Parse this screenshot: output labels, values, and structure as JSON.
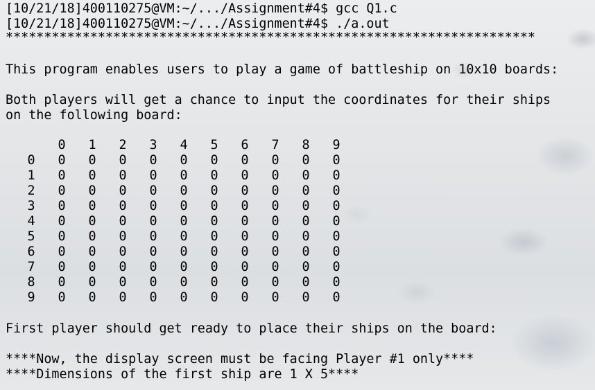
{
  "terminal": {
    "lines": {
      "prompt1": "[10/21/18]400110275@VM:~/.../Assignment#4$ gcc Q1.c",
      "prompt2": "[10/21/18]400110275@VM:~/.../Assignment#4$ ./a.out",
      "stars": "*********************************************************************",
      "intro": "This program enables users to play a game of battleship on 10x10 boards:",
      "both1": "Both players will get a chance to input the coordinates for their ships",
      "both2": "on the following board:",
      "first": "First player should get ready to place their ships on the board:",
      "now": "****Now, the display screen must be facing Player #1 only****",
      "dims": "****Dimensions of the first ship are 1 X 5****"
    },
    "board": {
      "col_headers": [
        "0",
        "1",
        "2",
        "3",
        "4",
        "5",
        "6",
        "7",
        "8",
        "9"
      ],
      "row_headers": [
        "0",
        "1",
        "2",
        "3",
        "4",
        "5",
        "6",
        "7",
        "8",
        "9"
      ],
      "cells": [
        [
          "0",
          "0",
          "0",
          "0",
          "0",
          "0",
          "0",
          "0",
          "0",
          "0"
        ],
        [
          "0",
          "0",
          "0",
          "0",
          "0",
          "0",
          "0",
          "0",
          "0",
          "0"
        ],
        [
          "0",
          "0",
          "0",
          "0",
          "0",
          "0",
          "0",
          "0",
          "0",
          "0"
        ],
        [
          "0",
          "0",
          "0",
          "0",
          "0",
          "0",
          "0",
          "0",
          "0",
          "0"
        ],
        [
          "0",
          "0",
          "0",
          "0",
          "0",
          "0",
          "0",
          "0",
          "0",
          "0"
        ],
        [
          "0",
          "0",
          "0",
          "0",
          "0",
          "0",
          "0",
          "0",
          "0",
          "0"
        ],
        [
          "0",
          "0",
          "0",
          "0",
          "0",
          "0",
          "0",
          "0",
          "0",
          "0"
        ],
        [
          "0",
          "0",
          "0",
          "0",
          "0",
          "0",
          "0",
          "0",
          "0",
          "0"
        ],
        [
          "0",
          "0",
          "0",
          "0",
          "0",
          "0",
          "0",
          "0",
          "0",
          "0"
        ],
        [
          "0",
          "0",
          "0",
          "0",
          "0",
          "0",
          "0",
          "0",
          "0",
          "0"
        ]
      ]
    }
  }
}
